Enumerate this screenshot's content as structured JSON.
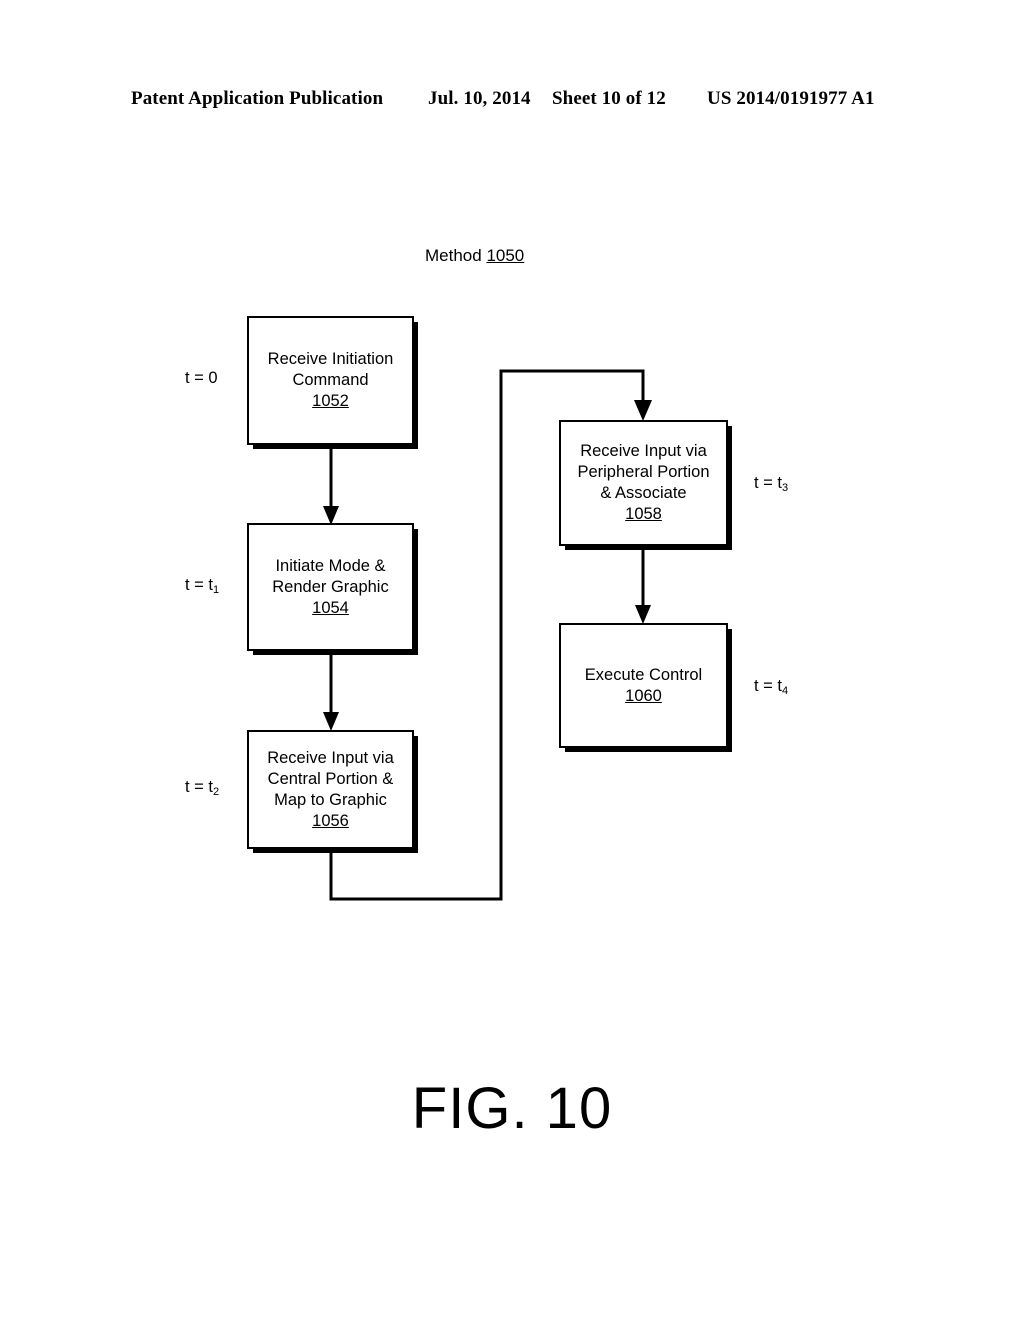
{
  "header": {
    "publication": "Patent Application Publication",
    "date": "Jul. 10, 2014",
    "sheet": "Sheet 10 of 12",
    "number": "US 2014/0191977 A1"
  },
  "figure": {
    "title_label": "Method",
    "title_ref": "1050",
    "caption": "FIG. 10"
  },
  "time_labels": {
    "t0": "t = 0",
    "t1_base": "t = t",
    "t1_sub": "1",
    "t2_base": "t = t",
    "t2_sub": "2",
    "t3_base": "t = t",
    "t3_sub": "3",
    "t4_base": "t = t",
    "t4_sub": "4"
  },
  "boxes": [
    {
      "id": "1052",
      "text": "Receive Initiation\nCommand",
      "ref": "1052"
    },
    {
      "id": "1054",
      "text": "Initiate Mode &\nRender Graphic",
      "ref": "1054"
    },
    {
      "id": "1056",
      "text": "Receive Input via\nCentral Portion &\nMap to Graphic",
      "ref": "1056"
    },
    {
      "id": "1058",
      "text": "Receive Input via\nPeripheral Portion\n& Associate",
      "ref": "1058"
    },
    {
      "id": "1060",
      "text": "Execute Control",
      "ref": "1060"
    }
  ],
  "colors": {
    "ink": "#000000",
    "paper": "#ffffff"
  }
}
